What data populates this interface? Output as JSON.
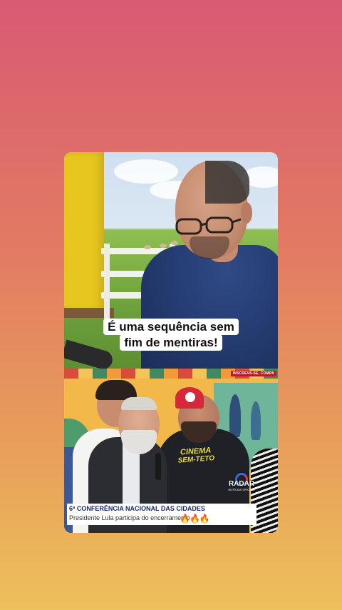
{
  "top_video": {
    "caption_line1": "É uma sequência sem",
    "caption_line2": "fim de mentiras!"
  },
  "bottom_video": {
    "subscribe_tag": "INSCREVA-SE, COMPA",
    "shirt_print_line1": "CINEMA",
    "shirt_print_line2": "SEM-TETO",
    "channel_logo": "RADAR",
    "channel_logo_sub": "NOTÍCIAS OFICIAIS",
    "lower_third_title": "6ª CONFERÊNCIA NACIONAL DAS CIDADES",
    "lower_third_subtitle": "Presidente Lula participa do encerramento",
    "reaction_emojis": "🔥🔥🔥"
  },
  "colors": {
    "background_top": "#d85a73",
    "background_bottom": "#ecc05a",
    "lower_third_title": "#1a2a6b",
    "cap_red": "#d5283a"
  }
}
